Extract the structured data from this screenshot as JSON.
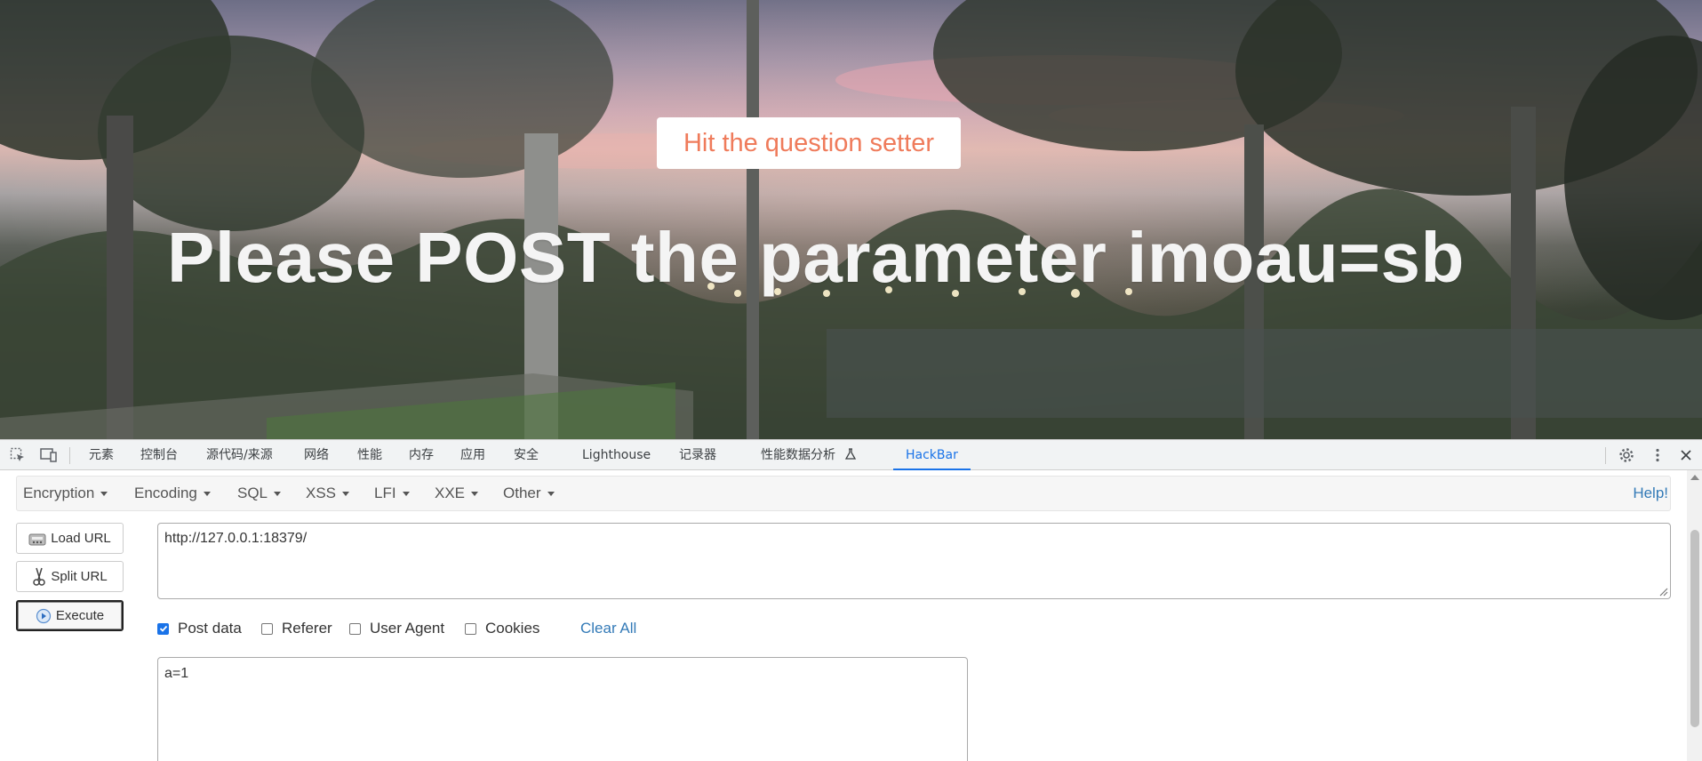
{
  "page": {
    "hit_button_label": "Hit the question setter",
    "headline": "Please POST the parameter imoau=sb"
  },
  "devtools": {
    "tabs": [
      {
        "label": "元素"
      },
      {
        "label": "控制台"
      },
      {
        "label": "源代码/来源"
      },
      {
        "label": "网络"
      },
      {
        "label": "性能"
      },
      {
        "label": "内存"
      },
      {
        "label": "应用"
      },
      {
        "label": "安全"
      },
      {
        "label": "Lighthouse"
      },
      {
        "label": "记录器"
      },
      {
        "label": "性能数据分析"
      },
      {
        "label": "HackBar"
      }
    ],
    "active_tab": "HackBar",
    "accent_color": "#1a73e8"
  },
  "hackbar": {
    "menus": [
      {
        "label": "Encryption"
      },
      {
        "label": "Encoding"
      },
      {
        "label": "SQL"
      },
      {
        "label": "XSS"
      },
      {
        "label": "LFI"
      },
      {
        "label": "XXE"
      },
      {
        "label": "Other"
      }
    ],
    "help_label": "Help!",
    "buttons": {
      "load_url": "Load URL",
      "split_url": "Split URL",
      "execute": "Execute"
    },
    "url_value": "http://127.0.0.1:18379/",
    "options": {
      "post_data": {
        "label": "Post data",
        "checked": true
      },
      "referer": {
        "label": "Referer",
        "checked": false
      },
      "user_agent": {
        "label": "User Agent",
        "checked": false
      },
      "cookies": {
        "label": "Cookies",
        "checked": false
      }
    },
    "clear_all_label": "Clear All",
    "post_body": "a=1",
    "link_color": "#337ab7"
  }
}
